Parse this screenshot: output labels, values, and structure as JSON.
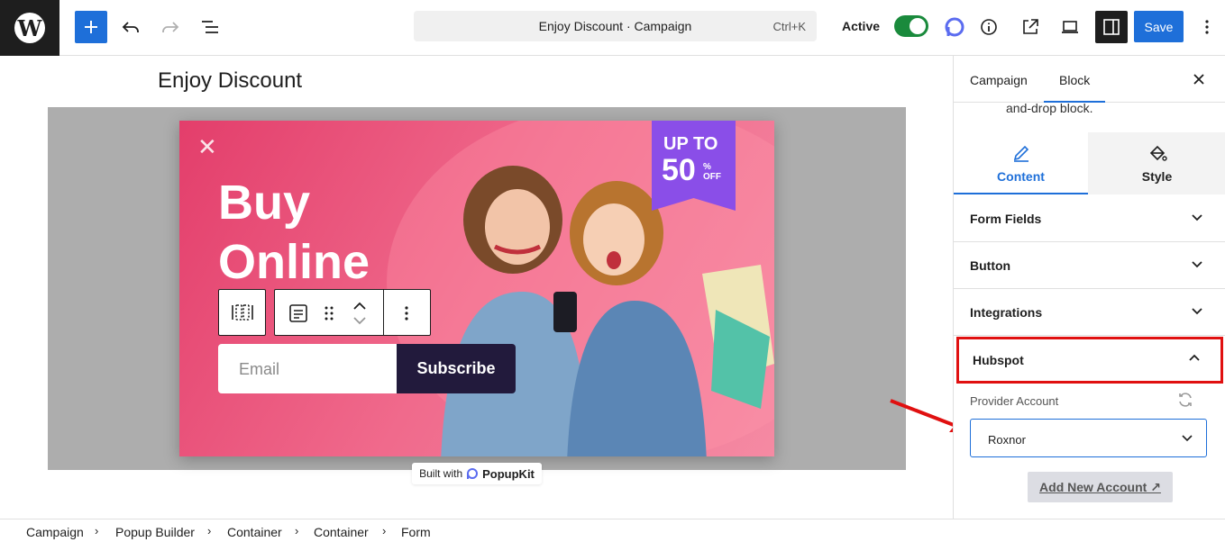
{
  "header": {
    "campaign_title": "Enjoy Discount · Campaign",
    "shortcut": "Ctrl+K",
    "status_label": "Active",
    "save_label": "Save",
    "accent_color": "#1e6fd9"
  },
  "editor": {
    "page_title": "Enjoy Discount",
    "popup": {
      "headline_line1": "Buy",
      "headline_line2": "Online",
      "badge_line1": "UP TO",
      "badge_value": "50",
      "badge_percent": "%",
      "badge_off": "OFF",
      "email_placeholder": "Email",
      "subscribe_label": "Subscribe"
    },
    "built_with_label": "Built with",
    "built_with_brand": "PopupKit"
  },
  "panel": {
    "tabs": [
      {
        "label": "Campaign"
      },
      {
        "label": "Block"
      }
    ],
    "description_fragment": "and-drop block.",
    "content_tab": "Content",
    "style_tab": "Style",
    "sections": [
      {
        "label": "Form Fields"
      },
      {
        "label": "Button"
      },
      {
        "label": "Integrations"
      },
      {
        "label": "Hubspot"
      }
    ],
    "provider_label": "Provider Account",
    "provider_value": "Roxnor",
    "add_account_label": "Add New Account ↗"
  },
  "breadcrumb": [
    "Campaign",
    "Popup Builder",
    "Container",
    "Container",
    "Form"
  ]
}
